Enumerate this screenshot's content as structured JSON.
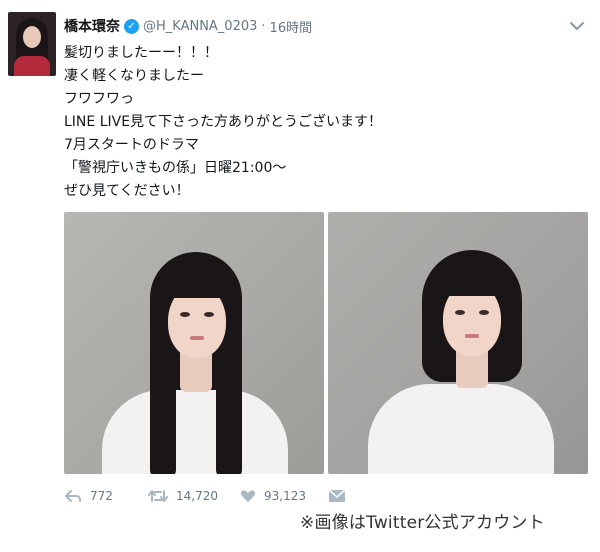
{
  "tweet": {
    "display_name": "橋本環奈",
    "handle": "@H_KANNA_0203",
    "separator": "·",
    "time": "16時間",
    "lines": [
      "髪切りましたーー！！！",
      "凄く軽くなりましたー",
      "フワフワっ",
      "LINE LIVE見て下さった方ありがとうございます！",
      "7月スタートのドラマ",
      "「警視庁いきもの係」日曜21:00〜",
      "ぜひ見てください！"
    ]
  },
  "actions": {
    "reply_count": "772",
    "retweet_count": "14,720",
    "like_count": "93,123"
  },
  "caption": "※画像はTwitter公式アカウント",
  "colors": {
    "verified": "#1da1f2",
    "meta": "#657786",
    "text": "#14171a"
  },
  "icons": [
    "verified-badge-icon",
    "chevron-down-icon",
    "reply-icon",
    "retweet-icon",
    "like-icon",
    "message-icon"
  ]
}
